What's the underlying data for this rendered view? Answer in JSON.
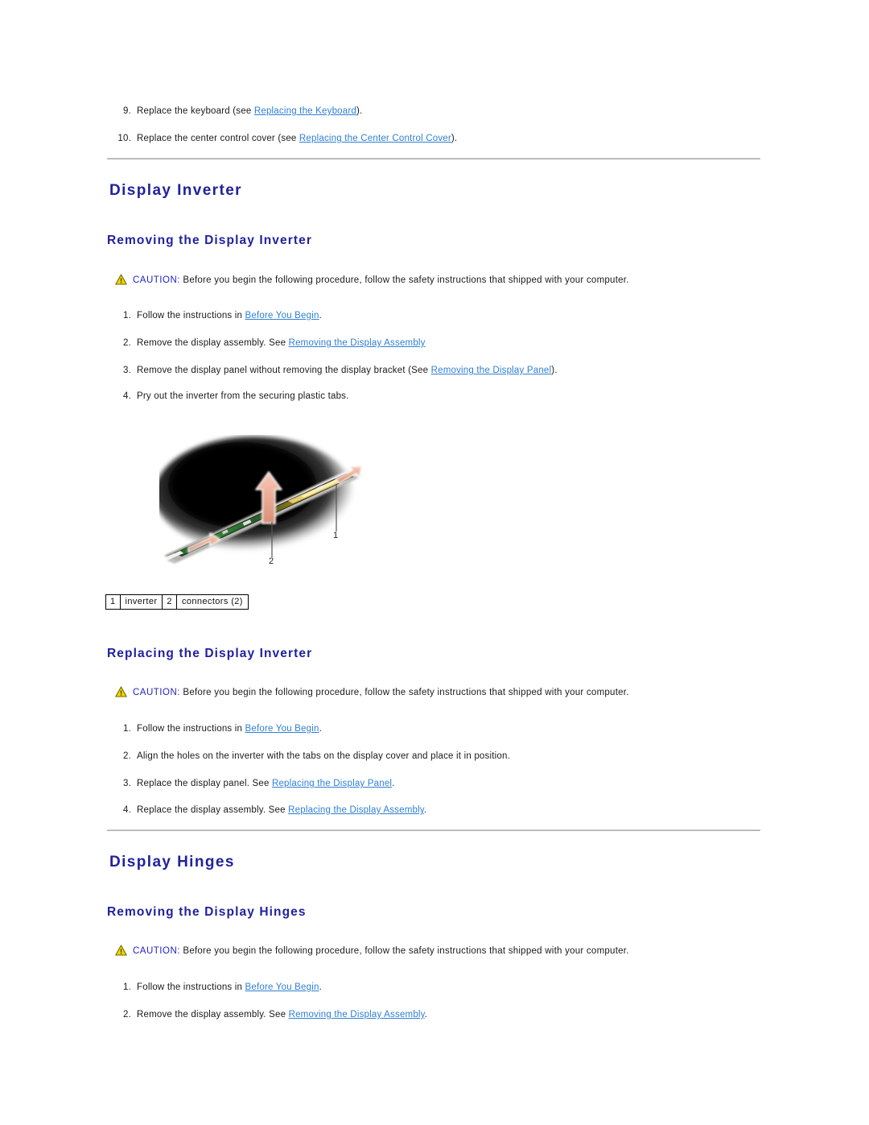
{
  "document": {
    "title": "Display Inverter / Display Hinges service procedures"
  },
  "top_list": {
    "items": [
      {
        "num": "9.",
        "pre": "Replace the keyboard (see ",
        "link": "Replacing the Keyboard",
        "post": ")."
      },
      {
        "num": "10.",
        "pre": "Replace the center control cover (see ",
        "link": "Replacing the Center Control Cover",
        "post": ")."
      }
    ]
  },
  "sections": [
    {
      "id": "display-inverter",
      "heading": "Display Inverter",
      "sub_removing": {
        "heading": "Removing the Display Inverter",
        "caution": {
          "keyword": "CAUTION:",
          "text": " Before you begin the following procedure, follow the safety instructions that shipped with your computer.",
          "icon": "warning-triangle-icon",
          "icon_fill": "#f2d400",
          "icon_stroke": "#6b6b00"
        },
        "steps": [
          {
            "num": "1.",
            "pre": "Follow the instructions in ",
            "link": "Before You Begin",
            "post": "."
          },
          {
            "num": "2.",
            "pre": "Remove the display assembly. See ",
            "link": "Removing the Display Assembly",
            "post": ""
          },
          {
            "num": "3.",
            "pre": "Remove the display panel without removing the display bracket (See ",
            "link": "Removing the Display Panel",
            "post": ")."
          },
          {
            "num": "4.",
            "pre": "Pry out the inverter from the securing plastic tabs.",
            "link": "",
            "post": ""
          }
        ],
        "figure": {
          "name": "display-inverter-removal-figure",
          "callouts": [
            {
              "label": "1"
            },
            {
              "label": "2"
            }
          ]
        },
        "legend": {
          "cells": [
            {
              "index": "1",
              "label": "inverter"
            },
            {
              "index": "2",
              "label": "connectors (2)"
            }
          ]
        }
      },
      "sub_replacing": {
        "heading": "Replacing the Display Inverter",
        "caution": {
          "keyword": "CAUTION:",
          "text": " Before you begin the following procedure, follow the safety instructions that shipped with your computer."
        },
        "steps": [
          {
            "num": "1.",
            "pre": "Follow the instructions in ",
            "link": "Before You Begin",
            "post": "."
          },
          {
            "num": "2.",
            "pre": "Align the holes on the inverter with the tabs on the display cover and place it in position.",
            "link": "",
            "post": ""
          },
          {
            "num": "3.",
            "pre": "Replace the display panel. See ",
            "link": "Replacing the Display Panel",
            "post": "."
          },
          {
            "num": "4.",
            "pre": "Replace the display assembly. See ",
            "link": "Replacing the Display Assembly",
            "post": "."
          }
        ]
      }
    },
    {
      "id": "display-hinges",
      "heading": "Display Hinges",
      "sub_removing": {
        "heading": "Removing the Display Hinges",
        "caution": {
          "keyword": "CAUTION:",
          "text": " Before you begin the following procedure, follow the safety instructions that shipped with your computer."
        },
        "steps": [
          {
            "num": "1.",
            "pre": "Follow the instructions in ",
            "link": "Before You Begin",
            "post": "."
          },
          {
            "num": "2.",
            "pre": "Remove the display assembly. See ",
            "link": "Removing the Display Assembly",
            "post": "."
          }
        ]
      }
    }
  ],
  "colors": {
    "heading_blue": "#21219e",
    "link_blue": "#2e7fd4",
    "caution_blue": "#2222c0",
    "rule_gray": "#b0b0b0",
    "arrow_salmon": "#e8a08c",
    "body_text": "#1a1a1a"
  }
}
